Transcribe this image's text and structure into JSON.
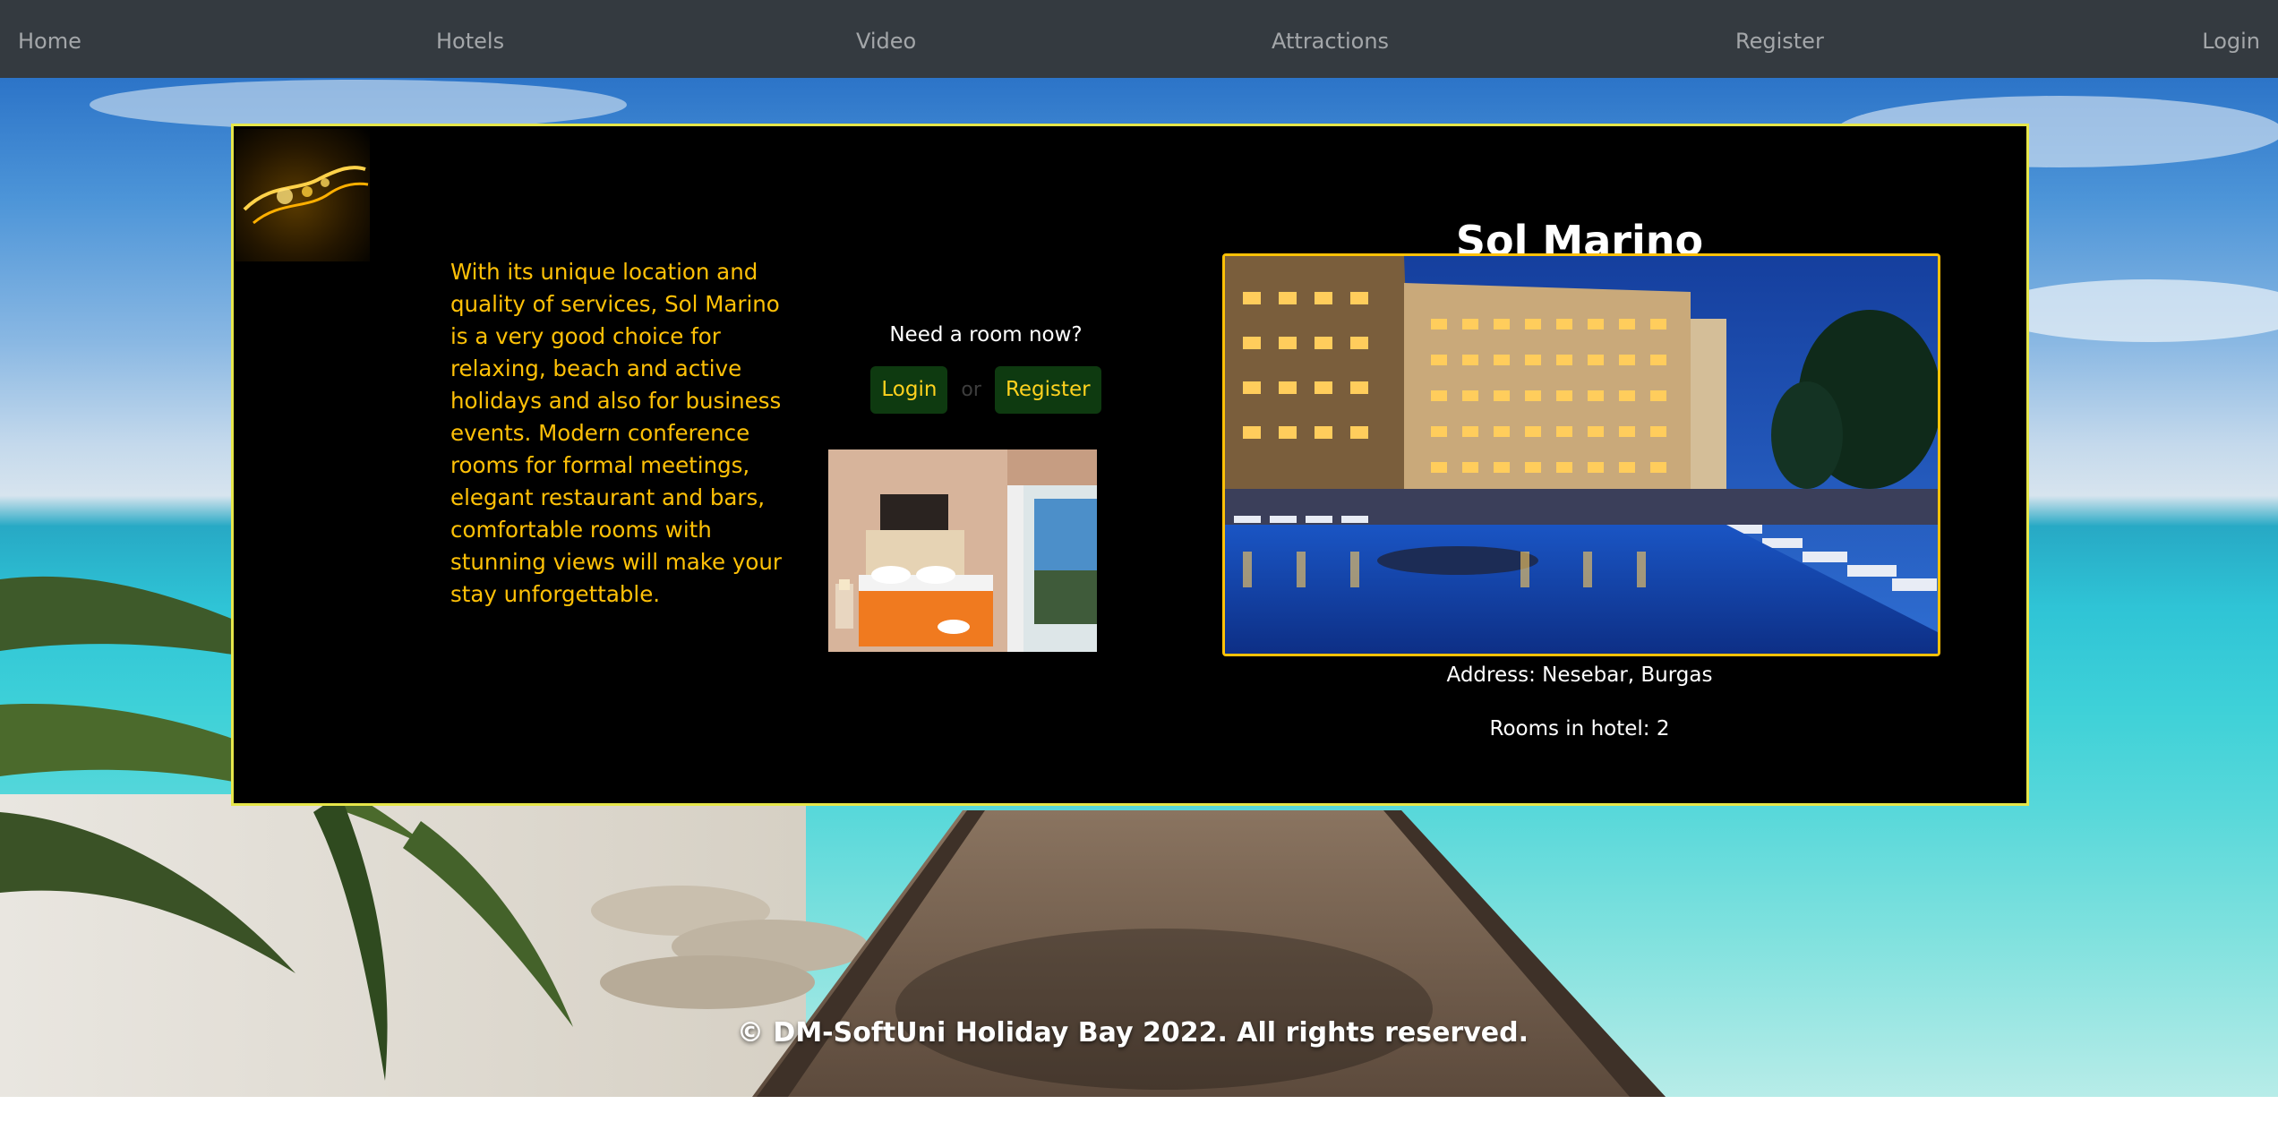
{
  "nav": {
    "home": "Home",
    "hotels": "Hotels",
    "video": "Video",
    "attractions": "Attractions",
    "register": "Register",
    "login": "Login"
  },
  "hotel": {
    "name": "Sol Marino",
    "description": "With its unique location and quality of services, Sol Marino is a very good choice for relaxing, beach and active holidays and also for business events. Modern conference rooms for formal meetings, elegant restaurant and bars, comfortable rooms with stunning views will make your stay unforgettable.",
    "address": "Address: Nesebar, Burgas",
    "rooms": "Rooms in hotel: 2"
  },
  "cta": {
    "prompt": "Need a room now?",
    "login_label": "Login",
    "or_text": "or",
    "register_label": "Register"
  },
  "footer": {
    "copyright": "© DM-SoftUni Holiday Bay 2022. All rights reserved."
  },
  "colors": {
    "navbar": "#343a40",
    "accent": "#ffc107",
    "card_border": "#e6e64a",
    "button_bg": "#0e3a10"
  }
}
